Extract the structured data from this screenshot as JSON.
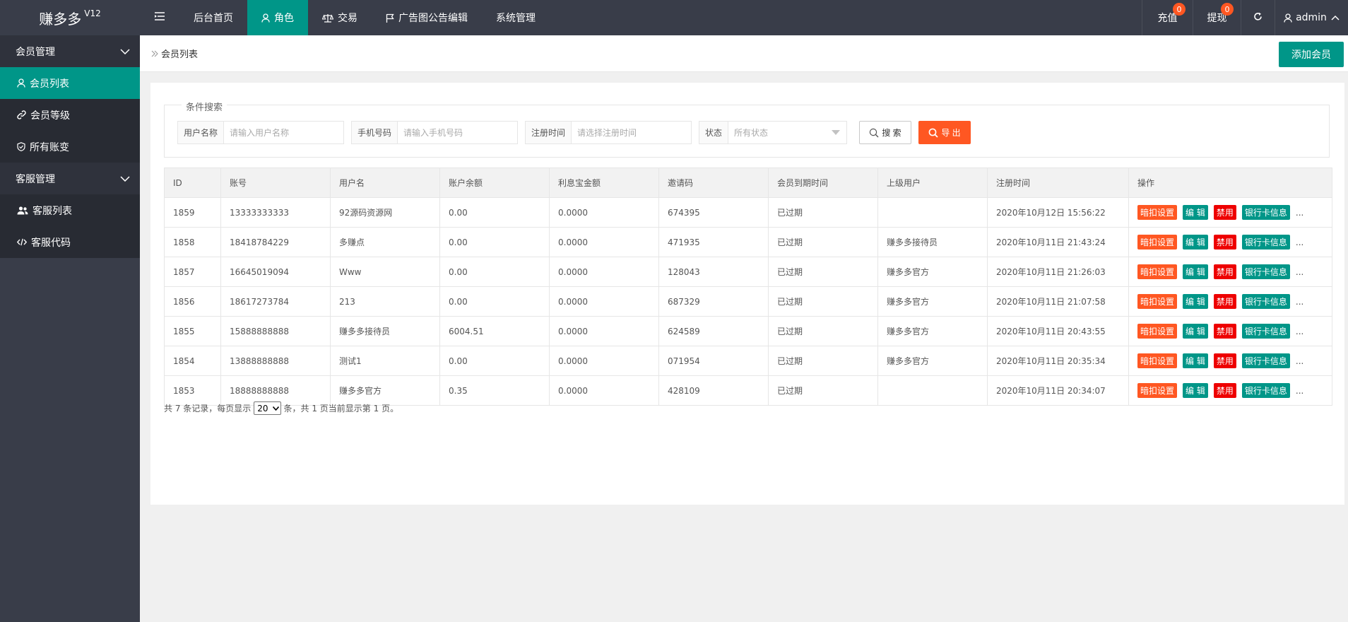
{
  "header": {
    "logo_text": "赚多多",
    "logo_version": "V12",
    "nav": [
      {
        "label": "后台首页",
        "icon": "none"
      },
      {
        "label": "角色",
        "icon": "user-icon",
        "active": true
      },
      {
        "label": "交易",
        "icon": "scale-icon"
      },
      {
        "label": "广告图公告编辑",
        "icon": "flag-icon"
      },
      {
        "label": "系统管理",
        "icon": "none"
      }
    ],
    "right": {
      "recharge_label": "充值",
      "recharge_badge": "0",
      "withdraw_label": "提现",
      "withdraw_badge": "0",
      "user_label": "admin"
    }
  },
  "sidebar": {
    "group1": "会员管理",
    "items1": [
      {
        "label": "会员列表",
        "icon": "user-icon",
        "active": true
      },
      {
        "label": "会员等级",
        "icon": "link-icon"
      },
      {
        "label": "所有账变",
        "icon": "shield-check-icon"
      }
    ],
    "group2": "客服管理",
    "items2": [
      {
        "label": "客服列表",
        "icon": "users-icon"
      },
      {
        "label": "客服代码",
        "icon": "code-icon"
      }
    ]
  },
  "breadcrumb": {
    "current": "会员列表"
  },
  "add_button": "添加会员",
  "search": {
    "legend": "条件搜索",
    "username_label": "用户名称",
    "username_placeholder": "请输入用户名称",
    "phone_label": "手机号码",
    "phone_placeholder": "请输入手机号码",
    "regtime_label": "注册时间",
    "regtime_placeholder": "请选择注册时间",
    "status_label": "状态",
    "status_value": "所有状态",
    "search_btn": "搜 索",
    "export_btn": "导 出"
  },
  "table": {
    "headers": [
      "ID",
      "账号",
      "用户名",
      "账户余额",
      "利息宝金额",
      "邀请码",
      "会员到期时间",
      "上级用户",
      "注册时间",
      "操作"
    ],
    "ops": {
      "deduct": "暗扣设置",
      "edit": "编 辑",
      "disable": "禁用",
      "bank": "银行卡信息",
      "more": "..."
    },
    "rows": [
      [
        "1859",
        "13333333333",
        "92源码资源网",
        "0.00",
        "0.0000",
        "674395",
        "已过期",
        "",
        "2020年10月12日 15:56:22"
      ],
      [
        "1858",
        "18418784229",
        "多赚点",
        "0.00",
        "0.0000",
        "471935",
        "已过期",
        "赚多多接待员",
        "2020年10月11日 21:43:24"
      ],
      [
        "1857",
        "16645019094",
        "Www",
        "0.00",
        "0.0000",
        "128043",
        "已过期",
        "赚多多官方",
        "2020年10月11日 21:26:03"
      ],
      [
        "1856",
        "18617273784",
        "213",
        "0.00",
        "0.0000",
        "687329",
        "已过期",
        "赚多多官方",
        "2020年10月11日 21:07:58"
      ],
      [
        "1855",
        "15888888888",
        "赚多多接待员",
        "6004.51",
        "0.0000",
        "624589",
        "已过期",
        "赚多多官方",
        "2020年10月11日 20:43:55"
      ],
      [
        "1854",
        "13888888888",
        "测试1",
        "0.00",
        "0.0000",
        "071954",
        "已过期",
        "赚多多官方",
        "2020年10月11日 20:35:34"
      ],
      [
        "1853",
        "18888888888",
        "赚多多官方",
        "0.35",
        "0.0000",
        "428109",
        "已过期",
        "",
        "2020年10月11日 20:34:07"
      ]
    ]
  },
  "pager": {
    "prefix": "共 7 条记录，每页显示",
    "page_size": "20",
    "suffix": "条，共 1 页当前显示第 1 页。"
  },
  "colors": {
    "accent": "#009688",
    "header_bg": "#393d49",
    "danger": "#ff5722",
    "disable_red": "#ee0000"
  }
}
